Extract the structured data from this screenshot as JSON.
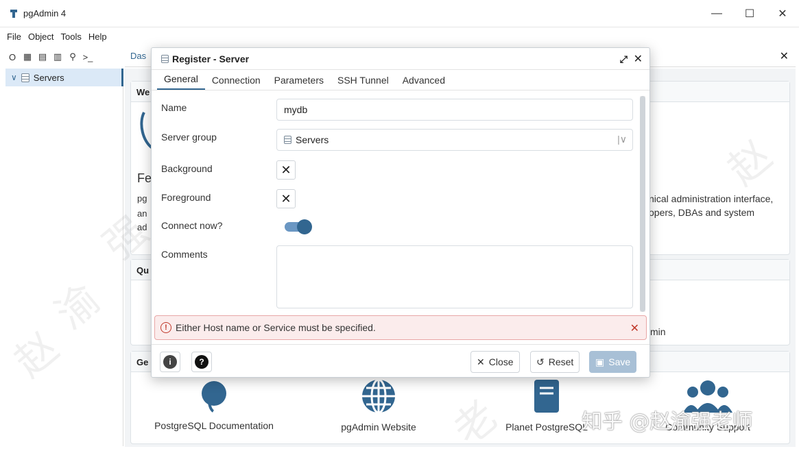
{
  "window": {
    "title": "pgAdmin 4",
    "controls": [
      "—",
      "☐",
      "✕"
    ]
  },
  "menu": [
    "File",
    "Object",
    "Tools",
    "Help"
  ],
  "browser": {
    "toolbar_text": "O",
    "tree": {
      "label": "Servers"
    }
  },
  "main": {
    "tab_label": "Das",
    "welcome_heading": "We",
    "feature_heading": "Fe",
    "body_fragments": [
      "pg",
      "an",
      "ad"
    ],
    "right_text_line1": "nical administration interface,",
    "right_text_line2": "opers, DBAs and system",
    "quick_heading": "Qu",
    "quick_fragment": "min",
    "getting_heading": "Ge",
    "links": [
      "PostgreSQL Documentation",
      "pgAdmin Website",
      "Planet PostgreSQL",
      "Community Support"
    ]
  },
  "dialog": {
    "title": "Register - Server",
    "tabs": [
      "General",
      "Connection",
      "Parameters",
      "SSH Tunnel",
      "Advanced"
    ],
    "active_tab": "General",
    "fields": {
      "name_label": "Name",
      "name_value": "mydb",
      "group_label": "Server group",
      "group_value": "Servers",
      "background_label": "Background",
      "foreground_label": "Foreground",
      "connect_label": "Connect now?",
      "connect_value": true,
      "comments_label": "Comments"
    },
    "error": "Either Host name or Service must be specified.",
    "buttons": {
      "close": "Close",
      "reset": "Reset",
      "save": "Save"
    }
  },
  "watermark": {
    "chars": [
      "赵",
      "渝",
      "强",
      "老",
      "师",
      "老",
      "赵"
    ],
    "zhihu": "知乎 @赵渝强老师"
  },
  "colors": {
    "accent": "#326690",
    "error": "#c0392b",
    "save_disabled": "#a8c0d6"
  }
}
